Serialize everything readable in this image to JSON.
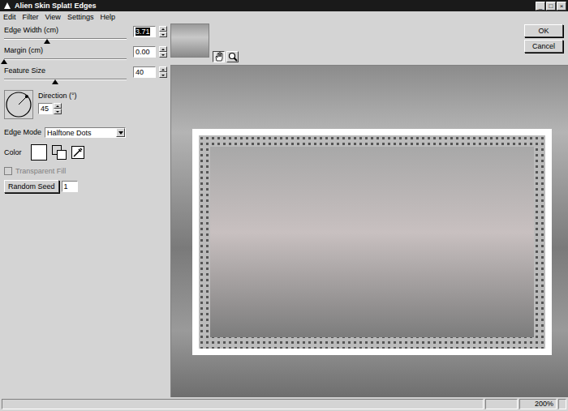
{
  "window": {
    "title": "Alien Skin Splat! Edges",
    "controls": [
      "_",
      "□",
      "×"
    ]
  },
  "menu": [
    "Edit",
    "Filter",
    "View",
    "Settings",
    "Help"
  ],
  "sliders": [
    {
      "label": "Edge Width (cm)",
      "value": "3.71",
      "level": 0.35,
      "value_selected": true
    },
    {
      "label": "Margin (cm)",
      "value": "0.00",
      "level": 0.0,
      "value_selected": false
    },
    {
      "label": "Feature Size",
      "value": "40",
      "level": 0.42,
      "value_selected": false
    }
  ],
  "direction": {
    "label": "Direction (°)",
    "value": "45"
  },
  "edge_mode": {
    "label": "Edge Mode",
    "value": "Halftone Dots"
  },
  "color": {
    "label": "Color",
    "value": "#ffffff"
  },
  "transparent_fill": {
    "label": "Transparent Fill",
    "checked": false,
    "disabled": true
  },
  "random_seed": {
    "button": "Random Seed",
    "value": "1"
  },
  "tools": [
    {
      "kind": "hand",
      "selected": true
    },
    {
      "kind": "zoom",
      "selected": false
    }
  ],
  "buttons": [
    "OK",
    "Cancel"
  ],
  "status_bar": {
    "zoom": "200%"
  }
}
